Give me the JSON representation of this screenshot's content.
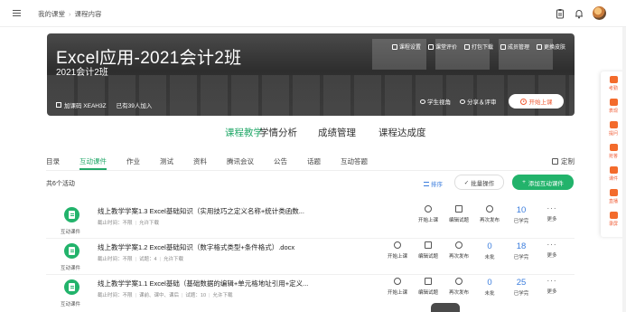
{
  "breadcrumb": {
    "home": "我的课堂",
    "current": "课程内容"
  },
  "banner": {
    "title": "Excel应用-2021会计2班",
    "class_name": "2021会计2班",
    "code_label": "加课码 XEAH3Z",
    "joined": "已有39人加入",
    "tools": [
      "课程设置",
      "课堂评价",
      "打包下载",
      "成员管理",
      "更换皮肤"
    ],
    "view_student": "学生视角",
    "share": "分享＆评审",
    "start_button": "开始上课"
  },
  "main_tabs": [
    "课程教学",
    "学情分析",
    "成绩管理",
    "课程达成度"
  ],
  "sub_tabs": [
    "目录",
    "互动课件",
    "作业",
    "测试",
    "资料",
    "腾讯会议",
    "公告",
    "话题",
    "互动答题"
  ],
  "custom": "定制",
  "activity_count": "共6个活动",
  "sort_label": "排序",
  "batch_label": "批量操作",
  "add_label": "添加互动课件",
  "activities": [
    {
      "type": "互动课件",
      "title": "线上教学学案1.3 Excel基础知识（实用技巧之定义名称+统计类函数...",
      "meta": [
        "截止时间：不限",
        "允许下载"
      ],
      "actions": [
        "开始上课",
        "编辑试题",
        "再次发布"
      ],
      "stats": [
        {
          "num": "10",
          "label": "已学完"
        }
      ],
      "more": "更多"
    },
    {
      "type": "互动课件",
      "title": "线上教学学案1.2 Excel基础知识（数字格式类型+条件格式）.docx",
      "meta": [
        "截止时间：不限",
        "试题：4",
        "允许下载"
      ],
      "actions": [
        "开始上课",
        "编辑试题",
        "再次发布"
      ],
      "stats": [
        {
          "num": "0",
          "label": "未批"
        },
        {
          "num": "18",
          "label": "已学完"
        }
      ],
      "more": "更多"
    },
    {
      "type": "互动课件",
      "title": "线上教学学案1.1 Excel基础（基础数据的编辑+单元格地址引用+定义...",
      "meta": [
        "截止时间：不限",
        "课前、课中、课后",
        "试题：10",
        "允许下载"
      ],
      "actions": [
        "开始上课",
        "编辑试题",
        "再次发布"
      ],
      "stats": [
        {
          "num": "0",
          "label": "未批"
        },
        {
          "num": "25",
          "label": "已学完"
        }
      ],
      "more": "更多"
    }
  ],
  "sidebar": [
    "考勤",
    "表现",
    "提问",
    "抢答",
    "课件",
    "直播",
    "录屏"
  ],
  "colors": {
    "accent": "#22a869",
    "primary_blue": "#3b7ddd",
    "orange": "#f05a33"
  }
}
